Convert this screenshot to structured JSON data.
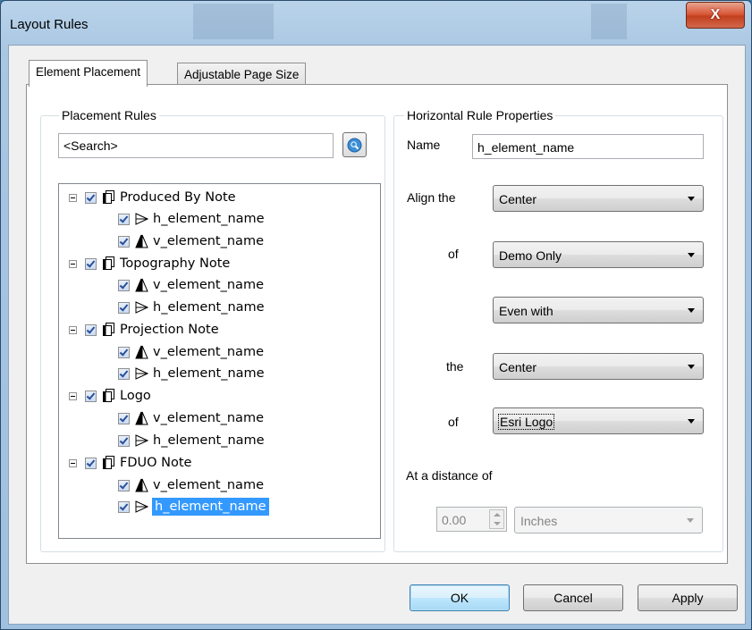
{
  "window": {
    "title": "Layout Rules",
    "close_glyph": "X"
  },
  "tabs": [
    {
      "label": "Element Placement",
      "active": true
    },
    {
      "label": "Adjustable Page Size",
      "active": false
    }
  ],
  "placement_rules": {
    "group_label": "Placement Rules",
    "search_placeholder": "<Search>",
    "search_icon": "magnifier-icon",
    "tree": [
      {
        "label": "Produced By Note",
        "checked": true,
        "children": [
          {
            "label": "h_element_name",
            "type": "horizontal",
            "checked": true
          },
          {
            "label": "v_element_name",
            "type": "vertical",
            "checked": true
          }
        ]
      },
      {
        "label": "Topography Note",
        "checked": true,
        "children": [
          {
            "label": "v_element_name",
            "type": "vertical",
            "checked": true
          },
          {
            "label": "h_element_name",
            "type": "horizontal",
            "checked": true
          }
        ]
      },
      {
        "label": "Projection Note",
        "checked": true,
        "children": [
          {
            "label": "v_element_name",
            "type": "vertical",
            "checked": true
          },
          {
            "label": "h_element_name",
            "type": "horizontal",
            "checked": true
          }
        ]
      },
      {
        "label": "Logo",
        "checked": true,
        "children": [
          {
            "label": "v_element_name",
            "type": "vertical",
            "checked": true
          },
          {
            "label": "h_element_name",
            "type": "horizontal",
            "checked": true
          }
        ]
      },
      {
        "label": "FDUO Note",
        "checked": true,
        "children": [
          {
            "label": "v_element_name",
            "type": "vertical",
            "checked": true
          },
          {
            "label": "h_element_name",
            "type": "horizontal",
            "checked": true,
            "selected": true
          }
        ]
      }
    ]
  },
  "properties": {
    "group_label": "Horizontal Rule Properties",
    "name_label": "Name",
    "name_value": "h_element_name",
    "align_label": "Align the",
    "align_value": "Center",
    "of_label_1": "of",
    "of_value_1": "Demo Only",
    "relation_value": "Even with",
    "the_label": "the",
    "the_value": "Center",
    "of_label_2": "of",
    "of_value_2": "Esri Logo",
    "distance_label": "At a distance of",
    "distance_value": "0.00",
    "units_value": "Inches"
  },
  "buttons": {
    "ok": "OK",
    "cancel": "Cancel",
    "apply": "Apply"
  }
}
